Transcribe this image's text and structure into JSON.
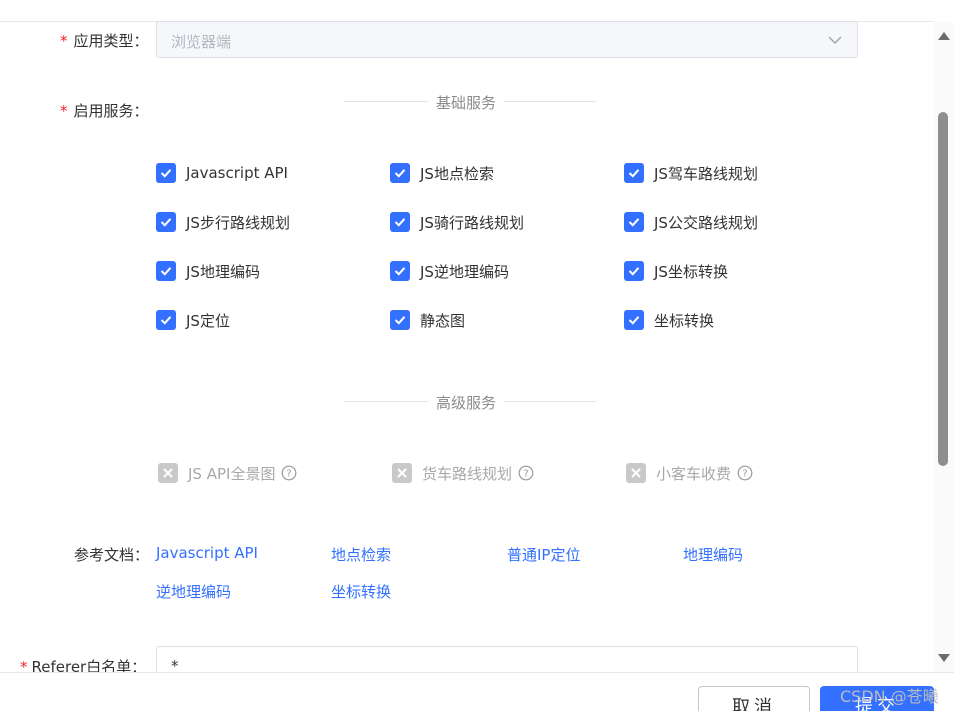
{
  "form": {
    "app_type": {
      "label": "应用类型：",
      "value": "浏览器端"
    },
    "services": {
      "label": "启用服务："
    },
    "basic_title": "基础服务",
    "basic_services": [
      "Javascript API",
      "JS地点检索",
      "JS驾车路线规划",
      "JS步行路线规划",
      "JS骑行路线规划",
      "JS公交路线规划",
      "JS地理编码",
      "JS逆地理编码",
      "JS坐标转换",
      "JS定位",
      "静态图",
      "坐标转换"
    ],
    "advanced_title": "高级服务",
    "advanced_services": [
      "JS API全景图",
      "货车路线规划",
      "小客车收费"
    ],
    "docs": {
      "label": "参考文档：",
      "links": [
        "Javascript API",
        "地点检索",
        "普通IP定位",
        "地理编码",
        "逆地理编码",
        "坐标转换"
      ]
    },
    "referer": {
      "label": "Referer白名单：",
      "value": "*"
    }
  },
  "footer": {
    "cancel_label": "取消",
    "submit_label": "提交",
    "watermark": "CSDN @苍曦"
  },
  "colors": {
    "primary": "#3370ff",
    "required": "#f5222d",
    "disabled": "#c9c9c9"
  }
}
